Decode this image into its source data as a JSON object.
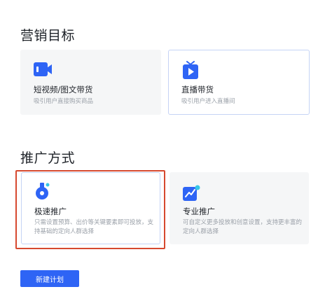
{
  "sections": {
    "goal_title": "营销目标",
    "method_title": "推广方式"
  },
  "goal_cards": {
    "short_video": {
      "title": "短视频/图文带货",
      "desc": "吸引用户直接购买商品",
      "icon": "video-camera-icon"
    },
    "live": {
      "title": "直播带货",
      "desc": "吸引用户进入直播间",
      "icon": "live-tv-icon"
    }
  },
  "method_cards": {
    "fast": {
      "title": "极速推广",
      "desc": "只需设置预算、出价等关键要素即可投放，支持基础的定向人群选择",
      "icon": "rocket-icon"
    },
    "pro": {
      "title": "专业推广",
      "desc": "可自定义更多投放和创意设置，支持更丰富的定向人群选择",
      "icon": "chart-trend-icon"
    }
  },
  "actions": {
    "create_plan": "新建计划"
  },
  "colors": {
    "primary": "#2e64f5",
    "highlight": "#d6492f",
    "card_bg": "#f5f6f7",
    "selected_border": "#c5d3f5"
  }
}
